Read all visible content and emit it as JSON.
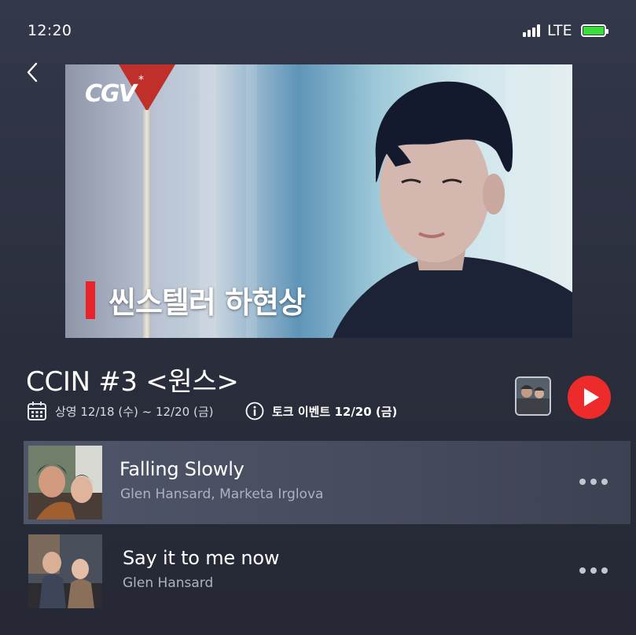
{
  "status_bar": {
    "time": "12:20",
    "network": "LTE"
  },
  "hero": {
    "logo_text": "CGV",
    "logo_mark": "*",
    "caption": "씬스텔러 하현상"
  },
  "event": {
    "title": "CCIN #3 <원스>",
    "schedule": "상영 12/18 (수) ~ 12/20 (금)",
    "talk_event": "토크 이벤트 12/20 (금)"
  },
  "tracks": [
    {
      "title": "Falling Slowly",
      "artist": "Glen Hansard, Marketa Irglova",
      "active": true
    },
    {
      "title": "Say it to me now",
      "artist": "Glen Hansard",
      "active": false
    }
  ],
  "colors": {
    "accent": "#ee2b2b",
    "caption_bar": "#e8232a",
    "battery": "#3ddc3d"
  },
  "icons": [
    "signal-icon",
    "battery-icon",
    "back-arrow-icon",
    "calendar-icon",
    "info-icon",
    "play-icon",
    "more-icon"
  ]
}
